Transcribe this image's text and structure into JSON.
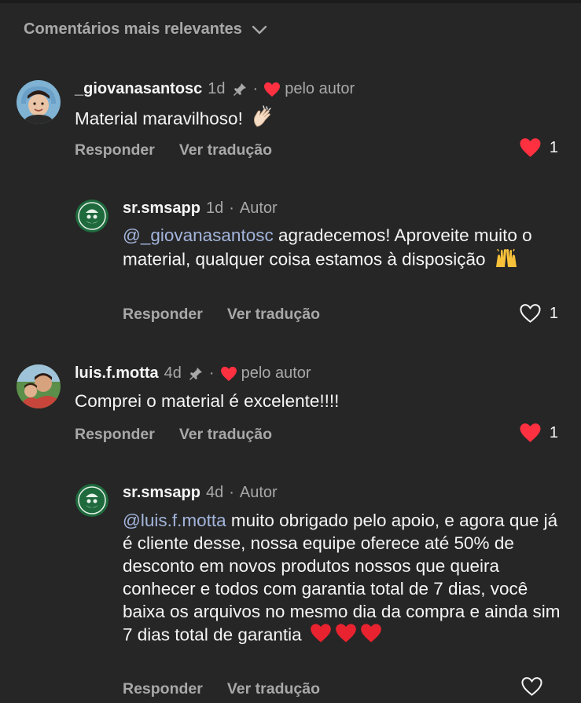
{
  "header": {
    "sort_label": "Comentários mais relevantes"
  },
  "comments": [
    {
      "username": "_giovanasantosc",
      "time": "1d",
      "author_like_label": "pelo autor",
      "text": "Material maravilhoso!",
      "emoji": "clapping-hands",
      "reply_label": "Responder",
      "translate_label": "Ver tradução",
      "likes": "1",
      "liked": true
    },
    {
      "username": "sr.smsapp",
      "time": "1d",
      "badge": "Autor",
      "mention": "@_giovanasantosc",
      "text": " agradecemos! Aproveite muito o material, qualquer coisa estamos à disposição",
      "emoji": "raising-hands",
      "reply_label": "Responder",
      "translate_label": "Ver tradução",
      "likes": "1",
      "liked": false
    },
    {
      "username": "luis.f.motta",
      "time": "4d",
      "author_like_label": "pelo autor",
      "text": "Comprei o material é excelente!!!!",
      "reply_label": "Responder",
      "translate_label": "Ver tradução",
      "likes": "1",
      "liked": true
    },
    {
      "username": "sr.smsapp",
      "time": "4d",
      "badge": "Autor",
      "mention": "@luis.f.motta",
      "text": " muito obrigado pelo apoio, e agora que já é cliente desse, nossa equipe oferece até 50% de desconto em novos produtos nossos que queira conhecer e todos com garantia total de 7 dias, você baixa os arquivos no mesmo dia da compra e ainda sim 7 dias total de garantia",
      "emoji": "red-hearts",
      "reply_label": "Responder",
      "translate_label": "Ver tradução",
      "likes": "",
      "liked": false
    }
  ],
  "colors": {
    "background": "#262626",
    "primary_text": "#f5f5f5",
    "secondary_text": "#a8a8a8",
    "mention": "#a3b5dc",
    "like_red": "#ff3040",
    "brand_green": "#1e6a3d"
  },
  "icons": [
    "chevron-down-icon",
    "pin-icon",
    "heart-icon"
  ]
}
